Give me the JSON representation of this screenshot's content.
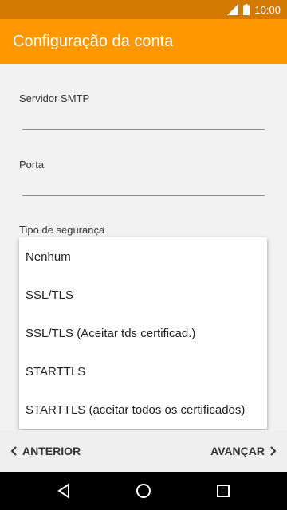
{
  "status_bar": {
    "time": "10:00"
  },
  "app_bar": {
    "title": "Configuração da conta"
  },
  "fields": {
    "smtp_label": "Servidor SMTP",
    "smtp_value": "",
    "port_label": "Porta",
    "port_value": "",
    "security_label": "Tipo de segurança"
  },
  "dropdown": {
    "options": [
      "Nenhum",
      "SSL/TLS",
      "SSL/TLS (Aceitar tds certificad.)",
      "STARTTLS",
      "STARTTLS (aceitar todos os certificados)"
    ]
  },
  "bottom_nav": {
    "prev_label": "ANTERIOR",
    "next_label": "AVANÇAR"
  },
  "colors": {
    "status_bar": "#d37800",
    "app_bar": "#ff9800"
  }
}
